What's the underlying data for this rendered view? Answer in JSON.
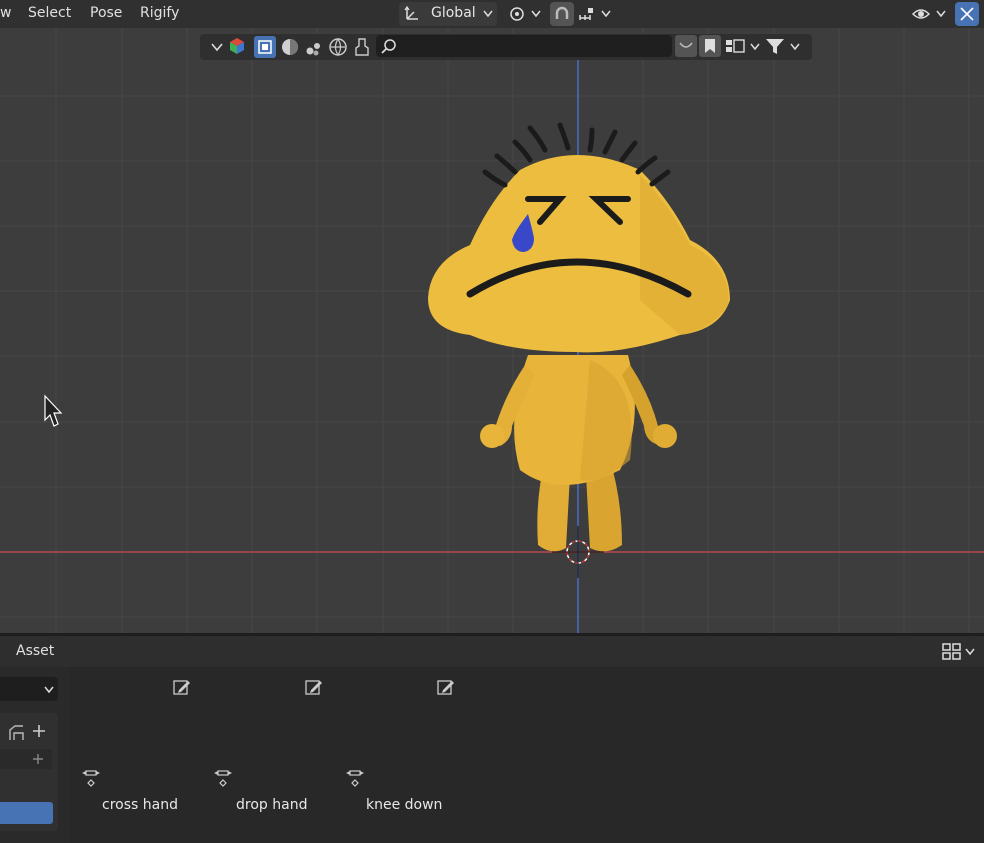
{
  "menu": {
    "view_partial": "w",
    "select": "Select",
    "pose": "Pose",
    "rigify": "Rigify"
  },
  "header": {
    "orientation": "Global"
  },
  "asset_shelf": {
    "tab_label": "Asset",
    "items": [
      {
        "label": "cross hand"
      },
      {
        "label": "drop hand"
      },
      {
        "label": "knee down"
      }
    ]
  },
  "colors": {
    "accent": "#4772b3",
    "background": "#3d3d3d",
    "x_axis": "#c84a4a",
    "y_axis": "#4a6fc8",
    "character_body": "#e8b53a"
  }
}
